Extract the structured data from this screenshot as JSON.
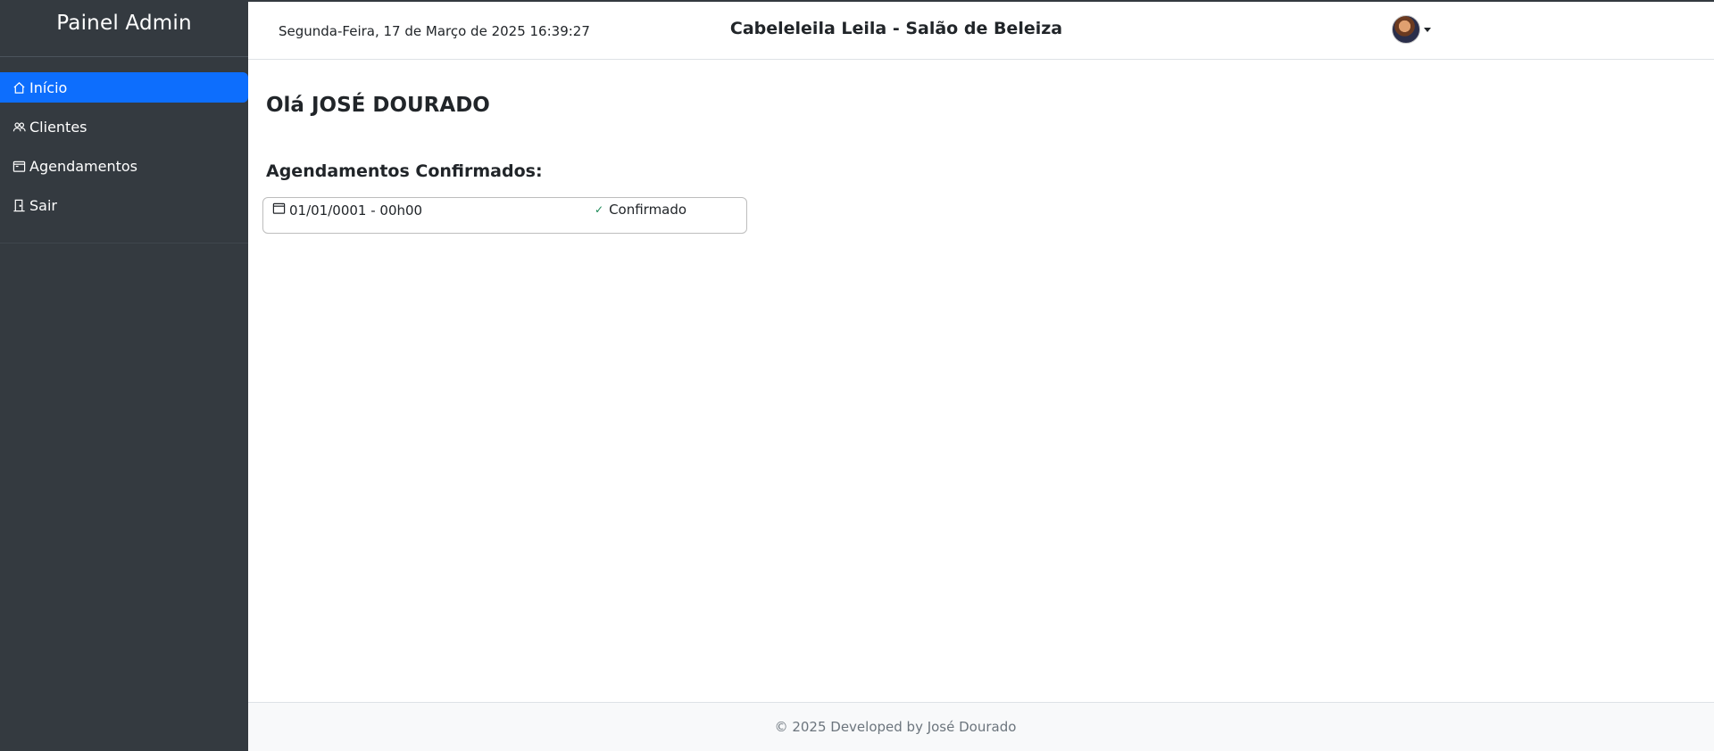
{
  "sidebar": {
    "brand": "Painel Admin",
    "items": [
      {
        "label": "Início",
        "icon": "home-icon",
        "active": true
      },
      {
        "label": "Clientes",
        "icon": "users-icon",
        "active": false
      },
      {
        "label": "Agendamentos",
        "icon": "calendar-icon",
        "active": false
      },
      {
        "label": "Sair",
        "icon": "door-exit-icon",
        "active": false
      }
    ]
  },
  "header": {
    "datetime": "Segunda-Feira, 17 de Março de 2025 16:39:27",
    "title": "Cabeleleila Leila - Salão de Beleiza",
    "user_avatar": "avatar"
  },
  "main": {
    "greeting": "Olá JOSÉ DOURADO",
    "section_title": "Agendamentos Confirmados:",
    "appointments": [
      {
        "datetime": "01/01/0001 - 00h00",
        "status": "Confirmado",
        "status_icon": "check-icon"
      }
    ]
  },
  "footer": {
    "text": "© 2025 Developed by José Dourado"
  },
  "colors": {
    "sidebar_bg": "#343a40",
    "accent": "#0d6efd",
    "confirmed": "#198754",
    "footer_bg": "#f8f9fa"
  }
}
